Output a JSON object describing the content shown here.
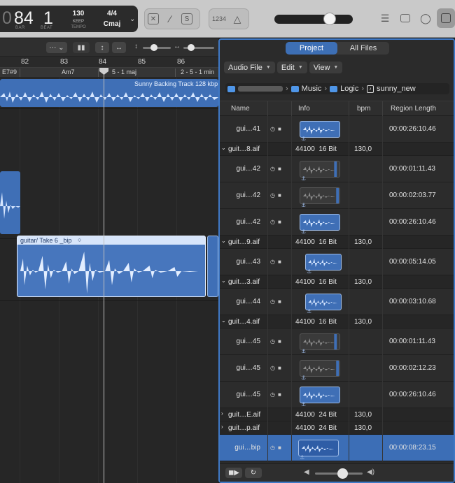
{
  "lcd": {
    "bar": "84",
    "beat": "1",
    "bar_label": "BAR",
    "beat_label": "BEAT",
    "tempo": "130",
    "tempo_mode": "KEEP",
    "tempo_label": "TEMPO",
    "signature": "4/4",
    "key": "Cmaj"
  },
  "toolbar": {
    "count_in": "1234"
  },
  "ruler": {
    "bars": [
      "82",
      "83",
      "84",
      "85",
      "86"
    ]
  },
  "chords": [
    "E7#9",
    "Am7",
    "5 - 1 maj",
    "2 - 5 - 1 min"
  ],
  "regions": {
    "backing": "Sunny Backing Track 128 kbp",
    "guitar": "guitar/ Take 6 _bip"
  },
  "browser": {
    "tabs": [
      "Project",
      "All Files"
    ],
    "menus": [
      "Audio File",
      "Edit",
      "View"
    ],
    "path": [
      "Music",
      "Logic",
      "sunny_new"
    ],
    "columns": {
      "name": "Name",
      "info": "Info",
      "bpm": "bpm",
      "length": "Region Length"
    },
    "rows": [
      {
        "kind": "sub",
        "name": "gui…41",
        "length": "00:00:26:10.46"
      },
      {
        "kind": "grp",
        "name": "guit…8.aif",
        "info": "44100  16 Bit",
        "bpm": "130,0"
      },
      {
        "kind": "sub",
        "name": "gui…42",
        "length": "00:00:01:11.43"
      },
      {
        "kind": "sub",
        "name": "gui…42",
        "length": "00:00:02:03.77"
      },
      {
        "kind": "sub",
        "name": "gui…42",
        "length": "00:00:26:10.46"
      },
      {
        "kind": "grp",
        "name": "guit…9.aif",
        "info": "44100  16 Bit",
        "bpm": "130,0"
      },
      {
        "kind": "sub",
        "name": "gui…43",
        "length": "00:00:05:14.05"
      },
      {
        "kind": "grp",
        "name": "guit…3.aif",
        "info": "44100  16 Bit",
        "bpm": "130,0"
      },
      {
        "kind": "sub",
        "name": "gui…44",
        "length": "00:00:03:10.68"
      },
      {
        "kind": "grp",
        "name": "guit…4.aif",
        "info": "44100  16 Bit",
        "bpm": "130,0"
      },
      {
        "kind": "sub",
        "name": "gui…45",
        "length": "00:00:01:11.43"
      },
      {
        "kind": "sub",
        "name": "gui…45",
        "length": "00:00:02:12.23"
      },
      {
        "kind": "sub",
        "name": "gui…45",
        "length": "00:00:26:10.46"
      },
      {
        "kind": "grp",
        "name": "guit…E.aif",
        "info": "44100  24 Bit",
        "bpm": "130,0"
      },
      {
        "kind": "grp",
        "name": "guit…p.aif",
        "info": "44100  24 Bit",
        "bpm": "130,0"
      },
      {
        "kind": "sel",
        "name": "gui…bip",
        "length": "00:00:08:23.15"
      }
    ]
  },
  "colors": {
    "region_blue": "#3f6fb6",
    "region_light": "#d6e6ff",
    "accent": "#3d6fb5"
  }
}
